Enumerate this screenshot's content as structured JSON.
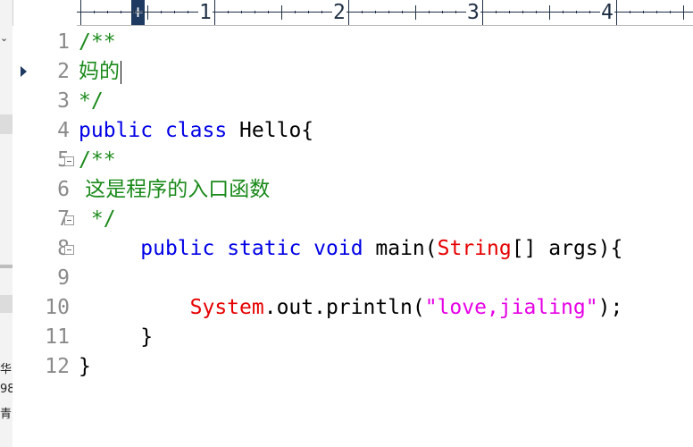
{
  "ruler": {
    "numbers": [
      "1",
      "2",
      "3",
      "4"
    ],
    "cursor_glyph": "+"
  },
  "side_panel": {
    "fragments": [
      "华",
      "98",
      "青"
    ]
  },
  "editor": {
    "current_line": 2,
    "lines": [
      {
        "num": "1",
        "fold": false,
        "tokens": [
          {
            "t": "/**",
            "c": "comment"
          }
        ]
      },
      {
        "num": "2",
        "fold": false,
        "tokens": [
          {
            "t": "妈的",
            "c": "comment"
          }
        ]
      },
      {
        "num": "3",
        "fold": false,
        "tokens": [
          {
            "t": "*/",
            "c": "comment"
          }
        ]
      },
      {
        "num": "4",
        "fold": false,
        "tokens": [
          {
            "t": "public",
            "c": "kw"
          },
          {
            "t": " ",
            "c": ""
          },
          {
            "t": "class",
            "c": "kw"
          },
          {
            "t": " Hello{",
            "c": ""
          }
        ]
      },
      {
        "num": "5",
        "fold": true,
        "tokens": [
          {
            "t": "/**",
            "c": "comment"
          }
        ]
      },
      {
        "num": "6",
        "fold": false,
        "tokens": [
          {
            "t": " 这是程序的入口函数",
            "c": "comment"
          }
        ]
      },
      {
        "num": "7",
        "fold": true,
        "tokens": [
          {
            "t": " */",
            "c": "comment"
          }
        ]
      },
      {
        "num": "8",
        "fold": true,
        "tokens": [
          {
            "t": "     ",
            "c": ""
          },
          {
            "t": "public",
            "c": "kw"
          },
          {
            "t": " ",
            "c": ""
          },
          {
            "t": "static",
            "c": "kw"
          },
          {
            "t": " ",
            "c": ""
          },
          {
            "t": "void",
            "c": "kw"
          },
          {
            "t": " main(",
            "c": ""
          },
          {
            "t": "String",
            "c": "cls"
          },
          {
            "t": "[] args){",
            "c": ""
          }
        ]
      },
      {
        "num": "9",
        "fold": false,
        "tokens": []
      },
      {
        "num": "10",
        "fold": false,
        "tokens": [
          {
            "t": "         ",
            "c": ""
          },
          {
            "t": "System",
            "c": "cls"
          },
          {
            "t": ".out.println(",
            "c": ""
          },
          {
            "t": "\"love,jialing\"",
            "c": "str"
          },
          {
            "t": ");",
            "c": ""
          }
        ]
      },
      {
        "num": "11",
        "fold": false,
        "tokens": [
          {
            "t": "     }",
            "c": ""
          }
        ]
      },
      {
        "num": "12",
        "fold": false,
        "tokens": [
          {
            "t": "}",
            "c": ""
          }
        ]
      }
    ]
  },
  "colors": {
    "comment": "#1a8a1a",
    "keyword": "#0000e6",
    "class": "#e60000",
    "string": "#e600e6",
    "line_number": "#8a8a8a"
  }
}
